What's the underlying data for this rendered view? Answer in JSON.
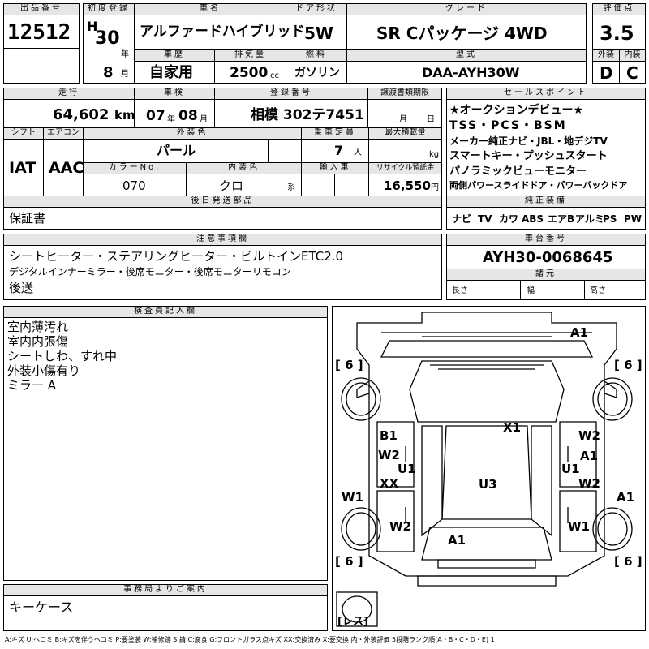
{
  "header": {
    "lot_label": "出品番号",
    "lot_no": "12512",
    "reg_label": "初度登録",
    "era": "H",
    "reg_year": "30",
    "year_unit": "年",
    "reg_month": "8",
    "month_unit": "月",
    "name_label": "車名",
    "car_name": "アルファードハイブリッド",
    "door_label": "ドア形状",
    "door": "5W",
    "grade_label": "グレード",
    "grade": "SR Cパッケージ 4WD",
    "score_label": "評価点",
    "score": "3.5",
    "history_label": "車歴",
    "history": "自家用",
    "disp_label": "排気量",
    "displacement": "2500",
    "disp_unit": "cc",
    "fuel_label": "燃料",
    "fuel": "ガソリン",
    "model_label": "型式",
    "model": "DAA-AYH30W",
    "ext_label": "外装",
    "ext_grade": "D",
    "int_label": "内装",
    "int_grade": "C"
  },
  "row2": {
    "mileage_label": "走行",
    "mileage": "64,602",
    "mileage_unit": "km",
    "inspect_label": "車検",
    "inspect_year": "07",
    "inspect_year_unit": "年",
    "inspect_month": "08",
    "inspect_month_unit": "月",
    "plate_label": "登録番号",
    "plate": "相模 302テ7451",
    "transfer_label": "譲渡書類期限",
    "transfer_month_unit": "月",
    "transfer_day_unit": "日",
    "shift_label": "シフト",
    "shift": "IAT",
    "ac_label": "エアコン",
    "ac": "AAC",
    "color_label": "外装色",
    "color": "パール",
    "capacity_label": "乗車定員",
    "capacity": "7",
    "capacity_unit": "人",
    "load_label": "最大積載量",
    "load_unit": "kg",
    "colorno_label": "カラーNo.",
    "color_no": "070",
    "intcolor_label": "内装色",
    "int_color": "クロ",
    "int_color_unit": "系",
    "import_label": "輸入車",
    "recycle_label": "リサイクル預託金",
    "recycle": "16,550",
    "recycle_unit": "円",
    "later_label": "後日発送部品",
    "later": "保証書"
  },
  "sales": {
    "label": "セールスポイント",
    "lines": [
      "★オークションデビュー★",
      "TSS・PCS・BSM",
      "メーカー純正ナビ・JBL・地デジTV",
      "スマートキー・プッシュスタート",
      "パノラミックビューモニター",
      "両側パワースライドドア・パワーバックドア"
    ],
    "equip_label": "純正装備",
    "equip": [
      "ナビ",
      "TV",
      "カワ",
      "ABS",
      "エアB",
      "アルミ",
      "PS",
      "PW"
    ]
  },
  "notes": {
    "label": "注意事項欄",
    "lines": [
      "シートヒーター・ステアリングヒーター・ビルトインETC2.0",
      "デジタルインナーミラー・後席モニター・後席モニターリモコン",
      "後送"
    ]
  },
  "chassis": {
    "label": "車台番号",
    "number": "AYH30-0068645",
    "dims_label": "諸元",
    "length": "長さ",
    "width": "幅",
    "height": "高さ"
  },
  "inspector": {
    "label": "検査員記入欄",
    "lines": [
      "室内薄汚れ",
      "室内内張傷",
      "シートしわ、すれ中",
      "外装小傷有り",
      "ミラー A"
    ]
  },
  "office": {
    "label": "事務局よりご案内",
    "text": "キーケース"
  },
  "diagram": {
    "marks": [
      "A1",
      "X1",
      "B1",
      "W2",
      "U1",
      "XX",
      "W1",
      "W2",
      "A1",
      "U3",
      "W2",
      "A1",
      "U1",
      "W2",
      "W1",
      "A1"
    ],
    "tires": [
      "6",
      "6",
      "6",
      "6"
    ],
    "spare": "レス"
  },
  "legend": "A:キズ U:ヘコミ B:キズを伴うヘコミ P:要塗装 W:補修跡 S:錆 C:腐食 G:フロントガラス点キズ XX:交換済み X:要交換 内・外装評価 5段階ランク順(A・B・C・D・E) 1"
}
